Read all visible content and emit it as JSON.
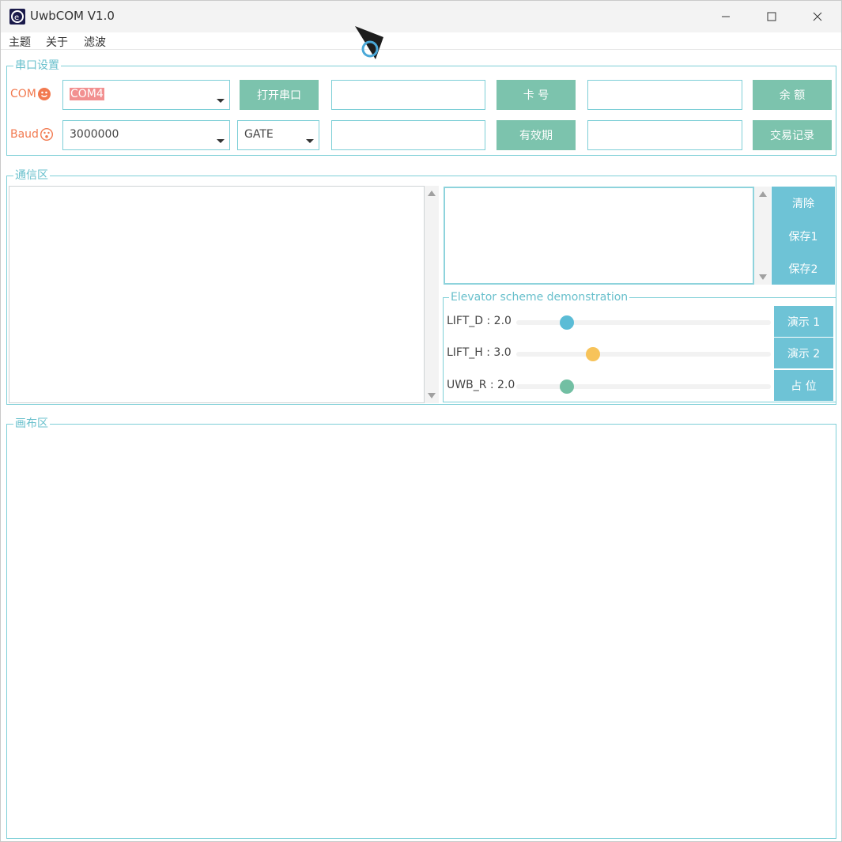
{
  "window": {
    "title": "UwbCOM V1.0"
  },
  "menu": [
    "主题",
    "关于",
    "滤波"
  ],
  "serial_group": {
    "legend": "串口设置",
    "com_label": "COM",
    "com_value": "COM4",
    "baud_label": "Baud",
    "baud_value": "3000000",
    "mode_value": "GATE",
    "open_button": "打开串口",
    "card_button": "卡  号",
    "expiry_button": "有效期",
    "balance_button": "余  额",
    "records_button": "交易记录"
  },
  "comm_group": {
    "legend": "通信区",
    "clear_button": "清除",
    "save1_button": "保存1",
    "save2_button": "保存2"
  },
  "elevator_group": {
    "legend": "Elevator scheme demonstration",
    "sliders": [
      {
        "label": "LIFT_D : 2.0",
        "fraction": 0.2,
        "color": "#5bbcd6"
      },
      {
        "label": "LIFT_H : 3.0",
        "fraction": 0.3,
        "color": "#f7c35a"
      },
      {
        "label": "UWB_R : 2.0",
        "fraction": 0.2,
        "color": "#72bfa3"
      }
    ],
    "demo1_button": "演示 1",
    "demo2_button": "演示 2",
    "placeholder_button": "占 位"
  },
  "canvas_group": {
    "legend": "画布区"
  },
  "colors": {
    "accent_teal": "#7ecfd7",
    "button_green": "#7cc3ad",
    "button_blue": "#6ec3d6",
    "label_orange": "#f27a50"
  }
}
